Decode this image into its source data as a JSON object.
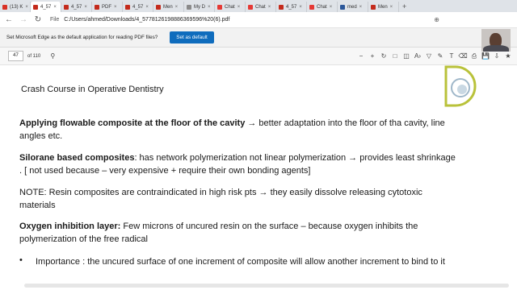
{
  "tabs": [
    {
      "label": "(13) K",
      "color": "#d93025"
    },
    {
      "label": "4_57",
      "color": "#c42b1c",
      "active": true
    },
    {
      "label": "4_57",
      "color": "#c42b1c"
    },
    {
      "label": "PDF",
      "color": "#c42b1c"
    },
    {
      "label": "4_57",
      "color": "#c42b1c"
    },
    {
      "label": "Men",
      "color": "#c42b1c"
    },
    {
      "label": "My D",
      "color": "#8a8a8a"
    },
    {
      "label": "Chat",
      "color": "#e53935"
    },
    {
      "label": "Chat",
      "color": "#e53935"
    },
    {
      "label": "4_57",
      "color": "#c42b1c"
    },
    {
      "label": "Chat",
      "color": "#e53935"
    },
    {
      "label": "med",
      "color": "#2b579a"
    },
    {
      "label": "Men",
      "color": "#c42b1c"
    }
  ],
  "address": {
    "scheme": "File",
    "url": "C:/Users/ahmed/Downloads/4_5778126198886369596%20(6).pdf"
  },
  "infobar": {
    "text": "Set Microsoft Edge as the default application for reading PDF files?",
    "button": "Set as default"
  },
  "pdf": {
    "page": "47",
    "of_total": "of 110"
  },
  "document": {
    "title": "Crash Course in Operative Dentistry",
    "p1_bold": "Applying flowable composite at the floor of the cavity",
    "p1_rest": " → better adaptation into the floor of tha cavity, line angles etc.",
    "p2_bold": "Silorane based composites",
    "p2_rest": ": has network polymerization not linear polymerization → provides least shrinkage . [ not used because – very expensive + require their own bonding agents]",
    "p3": "NOTE: Resin composites are contraindicated in high risk pts → they easily dissolve releasing cytotoxic materials",
    "p4_bold": "Oxygen inhibition layer:",
    "p4_rest": " Few microns of uncured resin on the surface – because oxygen inhibits the polymerization of the free radical",
    "bullet_symbol": "•",
    "bullet": "Importance : the uncured surface of one increment of composite will allow another increment to bind to it"
  }
}
